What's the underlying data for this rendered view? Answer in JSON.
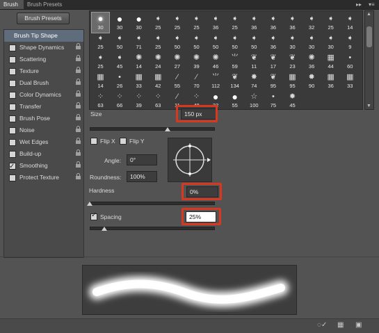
{
  "tabs": [
    {
      "label": "Brush",
      "active": true
    },
    {
      "label": "Brush Presets",
      "active": false
    }
  ],
  "window_controls": {
    "collapse": "▸▸",
    "menu": "▾≡"
  },
  "brush_presets_button": "Brush Presets",
  "sidebar": {
    "items": [
      {
        "label": "Brush Tip Shape",
        "selected": true,
        "checkbox": false
      },
      {
        "label": "Shape Dynamics",
        "checked": false
      },
      {
        "label": "Scattering",
        "checked": false
      },
      {
        "label": "Texture",
        "checked": false
      },
      {
        "label": "Dual Brush",
        "checked": false
      },
      {
        "label": "Color Dynamics",
        "checked": false
      },
      {
        "label": "Transfer",
        "checked": false
      },
      {
        "label": "Brush Pose",
        "checked": false
      },
      {
        "label": "Noise",
        "checked": false
      },
      {
        "label": "Wet Edges",
        "checked": false
      },
      {
        "label": "Build-up",
        "checked": false
      },
      {
        "label": "Smoothing",
        "checked": true
      },
      {
        "label": "Protect Texture",
        "checked": false
      }
    ]
  },
  "brush_tips": [
    {
      "size": "30",
      "icon": "soft-round",
      "selected": true
    },
    {
      "size": "30",
      "icon": "hard-round"
    },
    {
      "size": "30",
      "icon": "hard-round"
    },
    {
      "size": "25",
      "icon": "arrow-tip"
    },
    {
      "size": "25",
      "icon": "arrow-tip"
    },
    {
      "size": "25",
      "icon": "arrow-tip"
    },
    {
      "size": "36",
      "icon": "arrow-tip"
    },
    {
      "size": "25",
      "icon": "arrow-tip"
    },
    {
      "size": "36",
      "icon": "arrow-tip"
    },
    {
      "size": "36",
      "icon": "arrow-tip"
    },
    {
      "size": "36",
      "icon": "arrow-tip"
    },
    {
      "size": "32",
      "icon": "arrow-tip"
    },
    {
      "size": "25",
      "icon": "arrow-tip"
    },
    {
      "size": "14",
      "icon": "arrow-tip"
    },
    {
      "size": "25",
      "icon": "arrow-tip"
    },
    {
      "size": "50",
      "icon": "arrow-tip"
    },
    {
      "size": "71",
      "icon": "arrow-tip"
    },
    {
      "size": "25",
      "icon": "arrow-tip"
    },
    {
      "size": "50",
      "icon": "arrow-tip"
    },
    {
      "size": "50",
      "icon": "arrow-tip"
    },
    {
      "size": "50",
      "icon": "arrow-tip"
    },
    {
      "size": "50",
      "icon": "arrow-tip"
    },
    {
      "size": "50",
      "icon": "arrow-tip"
    },
    {
      "size": "36",
      "icon": "arrow-tip"
    },
    {
      "size": "30",
      "icon": "arrow-tip"
    },
    {
      "size": "30",
      "icon": "arrow-tip"
    },
    {
      "size": "30",
      "icon": "arrow-tip"
    },
    {
      "size": "9",
      "icon": "arrow-tip"
    },
    {
      "size": "25",
      "icon": "arrow-tip"
    },
    {
      "size": "45",
      "icon": "arrow-tip"
    },
    {
      "size": "14",
      "icon": "splatter"
    },
    {
      "size": "24",
      "icon": "splatter"
    },
    {
      "size": "27",
      "icon": "splatter"
    },
    {
      "size": "39",
      "icon": "splatter"
    },
    {
      "size": "46",
      "icon": "splatter"
    },
    {
      "size": "59",
      "icon": "grass"
    },
    {
      "size": "11",
      "icon": "leaf"
    },
    {
      "size": "17",
      "icon": "leaf"
    },
    {
      "size": "23",
      "icon": "leaf"
    },
    {
      "size": "36",
      "icon": "splatter"
    },
    {
      "size": "44",
      "icon": "chalk"
    },
    {
      "size": "60",
      "icon": "dot"
    },
    {
      "size": "14",
      "icon": "chalk"
    },
    {
      "size": "26",
      "icon": "dot"
    },
    {
      "size": "33",
      "icon": "chalk"
    },
    {
      "size": "42",
      "icon": "chalk"
    },
    {
      "size": "55",
      "icon": "brush-stroke"
    },
    {
      "size": "70",
      "icon": "brush-stroke"
    },
    {
      "size": "112",
      "icon": "grass"
    },
    {
      "size": "134",
      "icon": "leaf"
    },
    {
      "size": "74",
      "icon": "maple"
    },
    {
      "size": "95",
      "icon": "leaf"
    },
    {
      "size": "95",
      "icon": "chalk"
    },
    {
      "size": "90",
      "icon": "fuzzy-ball"
    },
    {
      "size": "36",
      "icon": "chalk"
    },
    {
      "size": "33",
      "icon": "chalk"
    },
    {
      "size": "63",
      "icon": "scatter-dots"
    },
    {
      "size": "66",
      "icon": "scatter-dots"
    },
    {
      "size": "39",
      "icon": "scatter-dots"
    },
    {
      "size": "63",
      "icon": "scatter-dots"
    },
    {
      "size": "11",
      "icon": "brush-stroke"
    },
    {
      "size": "48",
      "icon": "scatter-dots"
    },
    {
      "size": "32",
      "icon": "hard-round"
    },
    {
      "size": "55",
      "icon": "hard-round"
    },
    {
      "size": "100",
      "icon": "star"
    },
    {
      "size": "75",
      "icon": "dot"
    },
    {
      "size": "45",
      "icon": "fuzzy-ball"
    }
  ],
  "size": {
    "label": "Size",
    "value": "150 px",
    "slider_fraction": 0.6
  },
  "flip_x": {
    "label": "Flip X",
    "checked": false
  },
  "flip_y": {
    "label": "Flip Y",
    "checked": false
  },
  "angle": {
    "label": "Angle:",
    "value": "0°"
  },
  "roundness": {
    "label": "Roundness:",
    "value": "100%"
  },
  "hardness": {
    "label": "Hardness",
    "value": "0%",
    "slider_fraction": 0.0
  },
  "spacing": {
    "label": "Spacing",
    "value": "25%",
    "checked": true,
    "slider_fraction": 0.12
  },
  "bottom_icons": [
    "toggle-live-tip-icon",
    "grid-view-icon",
    "new-brush-icon"
  ],
  "colors": {
    "highlight": "#d9381e",
    "panel": "#535353",
    "selected_item": "#5e6c7c"
  }
}
